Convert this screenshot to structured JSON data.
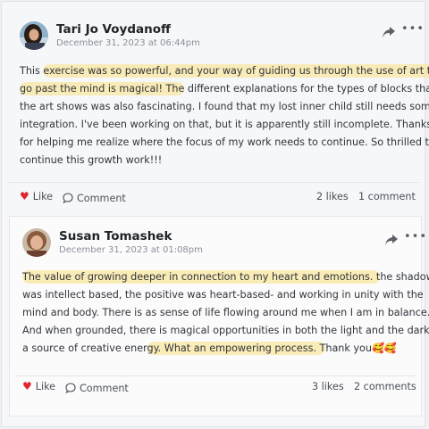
{
  "post1": {
    "author": "Tari Jo Voydanoff",
    "date": "December 31, 2023 at 06:44pm",
    "lines": [
      {
        "pre": "This ",
        "hl": "exercise was so powerful, and your way of guiding us through the use of art to",
        "post": ""
      },
      {
        "pre": "",
        "hl": "go past the mind is magical! The",
        "post": " different explanations for the types of blocks that"
      },
      {
        "pre": "the art shows was also fascinating. I found that my lost inner child still needs some",
        "hl": "",
        "post": ""
      },
      {
        "pre": "integration. I've been working on that, but it is apparently still incomplete. Thanks",
        "hl": "",
        "post": ""
      },
      {
        "pre": "for helping me realize where the focus of my work needs to continue. So thrilled to",
        "hl": "",
        "post": ""
      },
      {
        "pre": "continue this growth work!!!",
        "hl": "",
        "post": ""
      }
    ],
    "like_label": "Like",
    "comment_label": "Comment",
    "likes": "2 likes",
    "comments": "1 comment"
  },
  "post2": {
    "author": "Susan Tomashek",
    "date": "December 31, 2023 at 01:08pm",
    "lines": [
      {
        "pre": "",
        "hl": "The value of growing deeper in connection to my heart and emotions. t",
        "post": "he shadow"
      },
      {
        "pre": "was intellect based, the positive was heart-based- and working in unity with the",
        "hl": "",
        "post": ""
      },
      {
        "pre": "mind and body. There is as sense of life flowing around me when I am in balance.",
        "hl": "",
        "post": ""
      },
      {
        "pre": "And when grounded, there is magical opportunities in both the light and the dark as",
        "hl": "",
        "post": ""
      },
      {
        "pre": "a source of creative ener",
        "hl": "gy. What an empowering process. T",
        "post": "hank you🥰🥰"
      }
    ],
    "like_label": "Like",
    "comment_label": "Comment",
    "likes": "3 likes",
    "comments": "2 comments"
  },
  "icons": {
    "share": "share-arrow-icon",
    "more": "more-dots-icon",
    "like": "heart-icon",
    "comment": "speech-bubble-icon"
  },
  "colors": {
    "highlight": "#fae7a0",
    "heart": "#e0262c"
  }
}
